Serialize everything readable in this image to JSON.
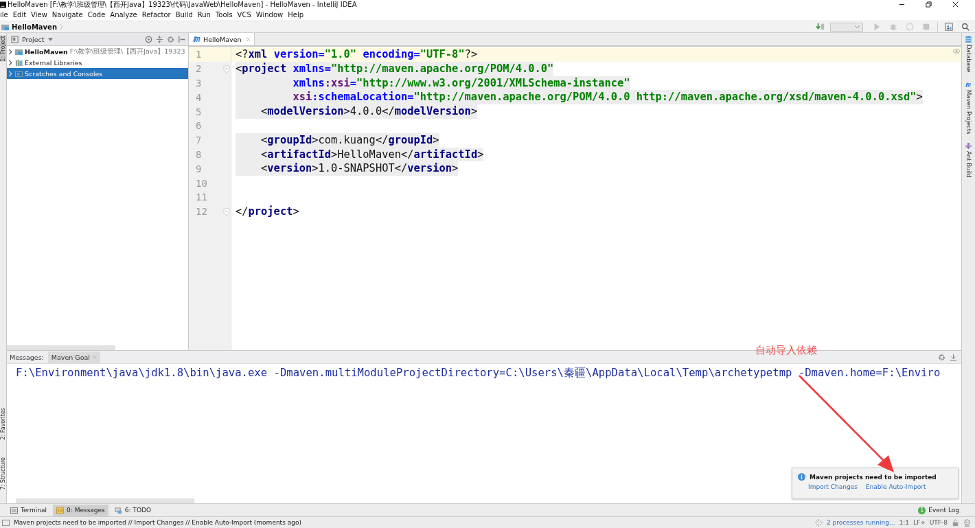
{
  "window": {
    "title": "HelloMaven [F:\\教学\\班级管理\\【西开Java】19323\\代码\\JavaWeb\\HelloMaven] - HelloMaven - IntelliJ IDEA"
  },
  "menu": [
    "ile",
    "Edit",
    "View",
    "Navigate",
    "Code",
    "Analyze",
    "Refactor",
    "Build",
    "Run",
    "Tools",
    "VCS",
    "Window",
    "Help"
  ],
  "breadcrumb": "HelloMaven",
  "left_stripe": [
    {
      "label": "1: Project",
      "selected": true
    },
    {
      "label": "2: Favorites",
      "selected": false
    },
    {
      "label": "7: Structure",
      "selected": false
    }
  ],
  "project_panel": {
    "title": "Project",
    "tree": [
      {
        "kind": "module",
        "label": "HelloMaven",
        "path": "F:\\教学\\班级管理\\【西开Java】19323",
        "selected": false
      },
      {
        "kind": "library",
        "label": "External Libraries",
        "selected": false
      },
      {
        "kind": "scratches",
        "label": "Scratches and Consoles",
        "selected": true
      }
    ]
  },
  "editor": {
    "tabs": [
      {
        "label": "HelloMaven",
        "selected": true
      }
    ],
    "lines": [
      {
        "n": "1",
        "current": true,
        "highlight": false,
        "fold": false,
        "tokens": [
          {
            "kind": "punct",
            "text": "<?"
          },
          {
            "kind": "tag",
            "text": "xml"
          },
          {
            "kind": "attr",
            "text": " version="
          },
          {
            "kind": "value",
            "text": "\"1.0\""
          },
          {
            "kind": "attr",
            "text": " encoding="
          },
          {
            "kind": "value",
            "text": "\"UTF-8\""
          },
          {
            "kind": "punct",
            "text": "?>"
          }
        ]
      },
      {
        "n": "2",
        "current": false,
        "highlight": true,
        "fold": true,
        "tokens": [
          {
            "kind": "punct",
            "text": "<"
          },
          {
            "kind": "tag",
            "text": "project"
          },
          {
            "kind": "attr",
            "text": " xmlns="
          },
          {
            "kind": "value",
            "text": "\"http://maven.apache.org/POM/4.0.0\""
          }
        ]
      },
      {
        "n": "3",
        "current": false,
        "highlight": true,
        "fold": false,
        "tokens": [
          {
            "kind": "attr",
            "text": "         xmlns"
          },
          {
            "kind": "ns",
            "text": ":xsi"
          },
          {
            "kind": "attr",
            "text": "="
          },
          {
            "kind": "value",
            "text": "\"http://www.w3.org/2001/XMLSchema-instance\""
          }
        ]
      },
      {
        "n": "4",
        "current": false,
        "highlight": true,
        "fold": false,
        "tokens": [
          {
            "kind": "ns",
            "text": "         xsi"
          },
          {
            "kind": "attr",
            "text": ":schemaLocation="
          },
          {
            "kind": "value",
            "text": "\"http://maven.apache.org/POM/4.0.0 http://maven.apache.org/xsd/maven-4.0.0.xsd\""
          },
          {
            "kind": "punct",
            "text": ">"
          }
        ]
      },
      {
        "n": "5",
        "current": false,
        "highlight": true,
        "fold": false,
        "tokens": [
          {
            "kind": "punct",
            "text": "    <"
          },
          {
            "kind": "tag",
            "text": "modelVersion"
          },
          {
            "kind": "punct",
            "text": ">4.0.0</"
          },
          {
            "kind": "tag",
            "text": "modelVersion"
          },
          {
            "kind": "punct",
            "text": ">"
          }
        ]
      },
      {
        "n": "6",
        "current": false,
        "highlight": false,
        "fold": false
      },
      {
        "n": "7",
        "current": false,
        "highlight": true,
        "fold": false,
        "tokens": [
          {
            "kind": "punct",
            "text": "    <"
          },
          {
            "kind": "tag",
            "text": "groupId"
          },
          {
            "kind": "punct",
            "text": ">com.kuang</"
          },
          {
            "kind": "tag",
            "text": "groupId"
          },
          {
            "kind": "punct",
            "text": ">"
          }
        ]
      },
      {
        "n": "8",
        "current": false,
        "highlight": true,
        "fold": false,
        "tokens": [
          {
            "kind": "punct",
            "text": "    <"
          },
          {
            "kind": "tag",
            "text": "artifactId"
          },
          {
            "kind": "punct",
            "text": ">HelloMaven</"
          },
          {
            "kind": "tag",
            "text": "artifactId"
          },
          {
            "kind": "punct",
            "text": ">"
          }
        ]
      },
      {
        "n": "9",
        "current": false,
        "highlight": true,
        "fold": false,
        "tokens": [
          {
            "kind": "punct",
            "text": "    <"
          },
          {
            "kind": "tag",
            "text": "version"
          },
          {
            "kind": "punct",
            "text": ">1.0-SNAPSHOT</"
          },
          {
            "kind": "tag",
            "text": "version"
          },
          {
            "kind": "punct",
            "text": ">"
          }
        ]
      },
      {
        "n": "10",
        "current": false,
        "highlight": false,
        "fold": false
      },
      {
        "n": "11",
        "current": false,
        "highlight": false,
        "fold": false
      },
      {
        "n": "12",
        "current": false,
        "highlight": false,
        "fold": true,
        "tokens": [
          {
            "kind": "punct",
            "text": "</"
          },
          {
            "kind": "tag",
            "text": "project"
          },
          {
            "kind": "punct",
            "text": ">"
          }
        ]
      }
    ]
  },
  "right_stripe": [
    {
      "kind": "database",
      "label": "Database"
    },
    {
      "kind": "maven",
      "label": "Maven Projects"
    },
    {
      "kind": "ant",
      "label": "Ant Build"
    }
  ],
  "messages": {
    "label": "Messages:",
    "tabs": [
      {
        "label": "Maven Goal",
        "selected": true
      }
    ],
    "output": [
      "F:\\Environment\\java\\jdk1.8\\bin\\java.exe -Dmaven.multiModuleProjectDirectory=C:\\Users\\秦疆\\AppData\\Local\\Temp\\archetypetmp -Dmaven.home=F:\\Enviro"
    ]
  },
  "annotation": {
    "text": "自动导入依赖"
  },
  "notification": {
    "title": "Maven projects need to be imported",
    "links": [
      "Import Changes",
      "Enable Auto-Import"
    ]
  },
  "tool_buttons": [
    {
      "kind": "terminal",
      "label": "Terminal",
      "selected": false
    },
    {
      "kind": "messages",
      "label": "0: Messages",
      "selected": true
    },
    {
      "kind": "todo",
      "label": "6: TODO",
      "selected": false
    }
  ],
  "event_log": {
    "label": "Event Log",
    "count": "1"
  },
  "status_bar": {
    "message": "Maven projects need to be imported // Import Changes // Enable Auto-Import (moments ago)",
    "processes": "2 processes running...",
    "position": "1:1",
    "line_separator": "LF÷",
    "encoding": "UTF-8"
  }
}
